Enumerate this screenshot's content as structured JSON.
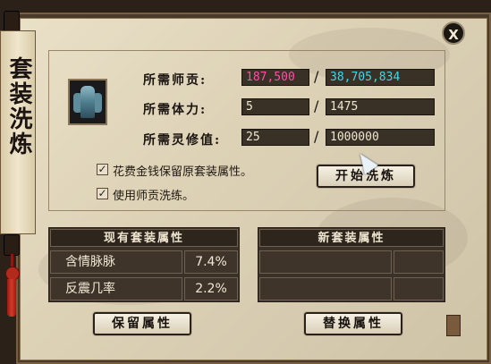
{
  "window": {
    "title": "套装洗炼",
    "close_label": "X"
  },
  "requirements": {
    "mentor_contribution": {
      "label": "所需师贡:",
      "current": "187,500",
      "total": "38,705,834"
    },
    "stamina": {
      "label": "所需体力:",
      "current": "5",
      "total": "1475"
    },
    "spirit": {
      "label": "所需灵修值:",
      "current": "25",
      "total": "1000000"
    }
  },
  "options": {
    "keep_attributes": {
      "label": "花费金钱保留原套装属性。",
      "checked": true,
      "mark": "✓"
    },
    "use_contribution": {
      "label": "使用师贡洗练。",
      "checked": true,
      "mark": "✓"
    }
  },
  "buttons": {
    "start": "开始洗炼",
    "keep": "保留属性",
    "replace": "替换属性"
  },
  "current_set": {
    "header": "现有套装属性",
    "rows": [
      {
        "name": "含情脉脉",
        "value": "7.4%"
      },
      {
        "name": "反震几率",
        "value": "2.2%"
      }
    ]
  },
  "new_set": {
    "header": "新套装属性",
    "rows": [
      {
        "name": "",
        "value": ""
      },
      {
        "name": "",
        "value": ""
      }
    ]
  },
  "colors": {
    "contribution_current": "#ff4fa3",
    "contribution_total": "#40d8e8",
    "field_text": "#efe6d2",
    "parchment": "#e2d8be"
  }
}
